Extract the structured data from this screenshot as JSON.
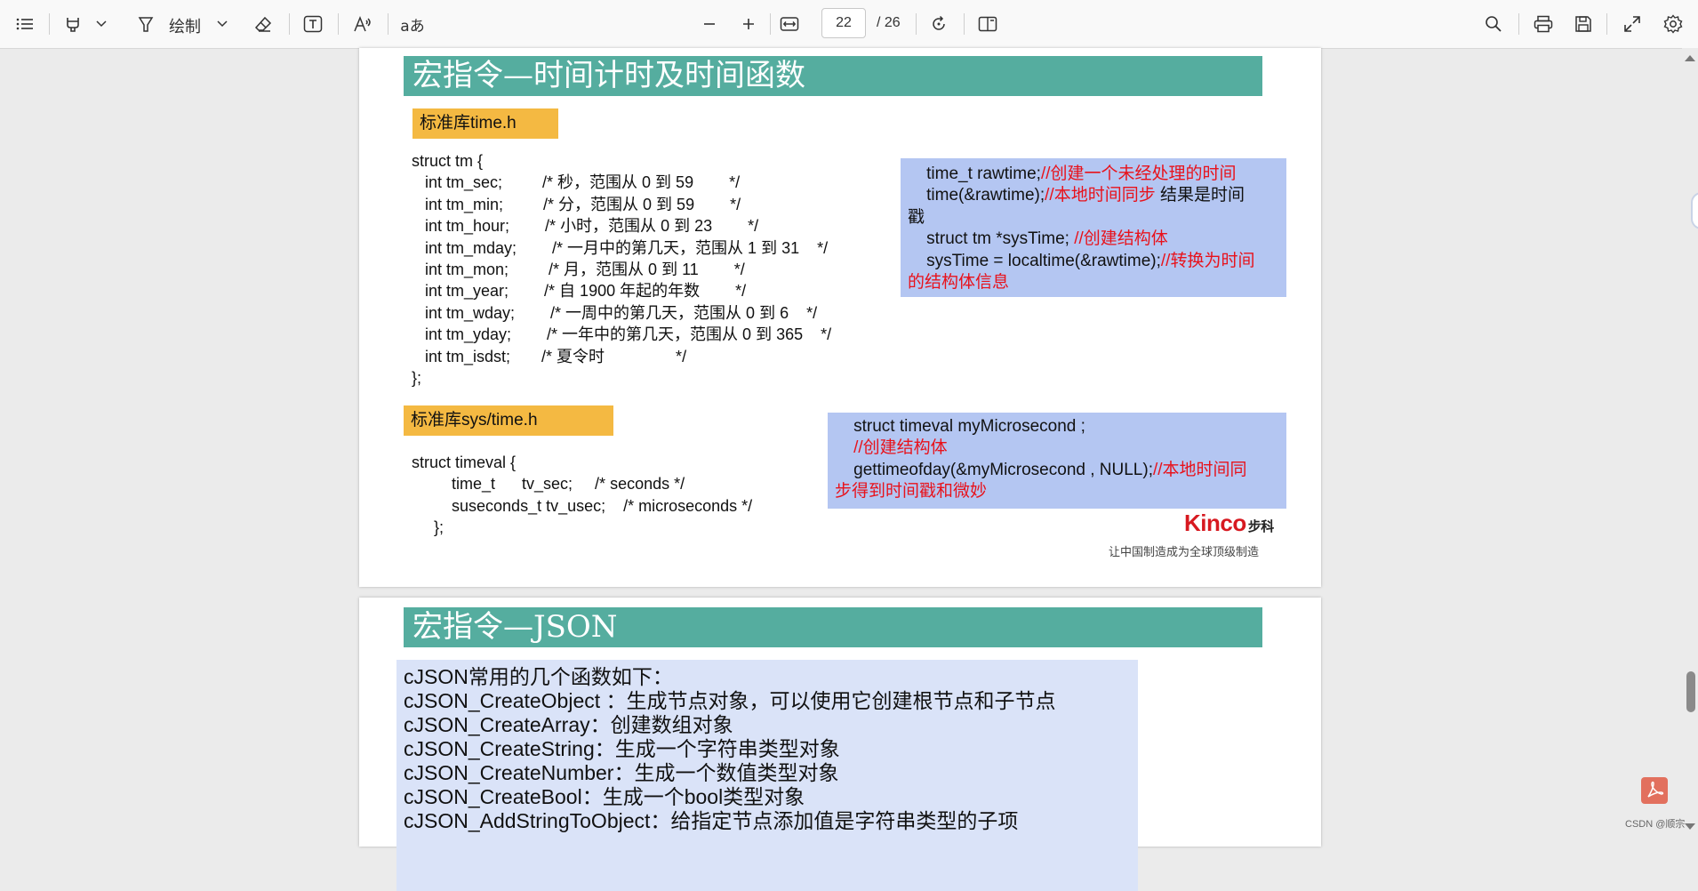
{
  "toolbar": {
    "draw_label": "绘制",
    "translate_glyph": "aあ",
    "current_page": "22",
    "total_pages": "/ 26"
  },
  "page1": {
    "title": "宏指令—时间计时及时间函数",
    "tag_time": "标准库time.h",
    "struct_tm_code": "struct tm {\n   int tm_sec;         /* 秒，范围从 0 到 59        */\n   int tm_min;         /* 分，范围从 0 到 59        */\n   int tm_hour;        /* 小时，范围从 0 到 23        */\n   int tm_mday;        /* 一月中的第几天，范围从 1 到 31    */\n   int tm_mon;         /* 月，范围从 0 到 11        */\n   int tm_year;        /* 自 1900 年起的年数        */\n   int tm_wday;        /* 一周中的第几天，范围从 0 到 6    */\n   int tm_yday;        /* 一年中的第几天，范围从 0 到 365    */\n   int tm_isdst;       /* 夏令时                */\n};",
    "box1": {
      "l1_code": "time_t rawtime;",
      "l1_comment": "//创建一个未经处理的时间",
      "l2_code": "time(&rawtime);",
      "l2_comment": "//本地时间同步",
      "l2_tail": " 结果是时间",
      "l3": "戳",
      "l4_code": "struct tm *sysTime; ",
      "l4_comment": "//创建结构体",
      "l5_code": "sysTime = localtime(&rawtime);",
      "l5_comment": "//转换为时间",
      "l6_comment": "的结构体信息"
    },
    "tag_sys_time": "标准库sys/time.h",
    "timeval_code": "struct timeval {\n         time_t      tv_sec;     /* seconds */\n         suseconds_t tv_usec;    /* microseconds */\n     };",
    "box2": {
      "l1": "struct timeval myMicrosecond ;",
      "l2_comment": "//创建结构体",
      "l3_code": "gettimeofday(&myMicrosecond , NULL);",
      "l3_comment": "//本地时间同",
      "l4_comment": "步得到时间戳和微妙"
    },
    "logo_brand": "Kinco",
    "logo_cn": "步科",
    "slogan": "让中国制造成为全球顶级制造"
  },
  "page2": {
    "title": "宏指令—JSON",
    "lines": [
      "cJSON常用的几个函数如下：",
      "cJSON_CreateObject ：生成节点对象，可以使用它创建根节点和子节点",
      "cJSON_CreateArray：创建数组对象",
      "cJSON_CreateString：生成一个字符串类型对象",
      "cJSON_CreateNumber：生成一个数值类型对象",
      "cJSON_CreateBool：生成一个bool类型对象",
      "cJSON_AddStringToObject：给指定节点添加值是字符串类型的子项"
    ]
  },
  "watermark": "CSDN @顺宗",
  "colors": {
    "title_bar": "#55ad9f",
    "tag": "#f4b942",
    "blue_box": "#b4c6f2",
    "json_box": "#dae3f8",
    "comment_red": "#e8121b"
  }
}
